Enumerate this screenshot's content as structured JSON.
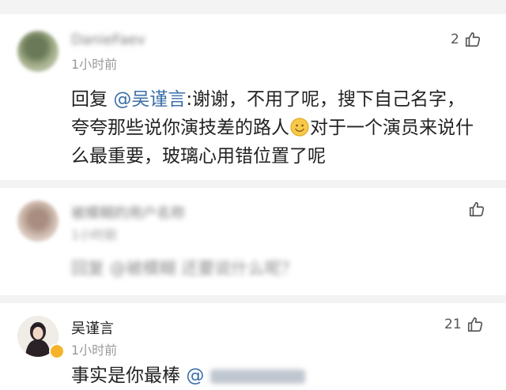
{
  "comments": [
    {
      "username": "DanieFaev",
      "time": "1小时前",
      "likes": "2",
      "reply_prefix": "回复",
      "mention": "@吴谨言",
      "text": ":谢谢，不用了呢，搜下自己名字，夸夸那些说你演技差的路人",
      "emoji": "smile-face-icon",
      "text_after": "对于一个演员来说什么最重要，玻璃心用错位置了呢"
    },
    {
      "username": "被模糊的用户名称",
      "time": "1小时前",
      "likes": "",
      "text": "回复 @被模糊 还要说什么呢？"
    },
    {
      "username": "吴谨言",
      "time": "1小时前",
      "likes": "21",
      "text": "事实是你最棒",
      "mention": "@"
    }
  ],
  "colors": {
    "mention": "#3b6ea8",
    "divider": "#f3f3f3",
    "verified": "#f6b32a"
  }
}
